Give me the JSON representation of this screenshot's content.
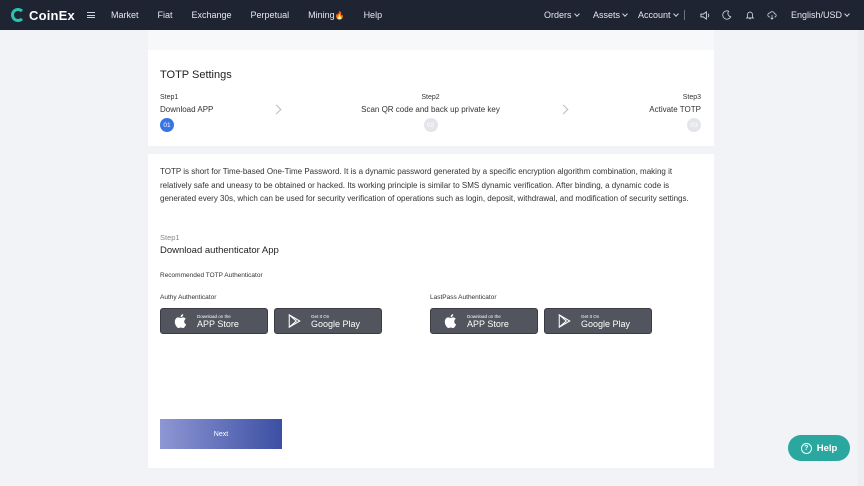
{
  "nav": {
    "logo": "CoinEx",
    "items": [
      "Market",
      "Fiat",
      "Exchange",
      "Perpetual",
      "Mining",
      "Help"
    ],
    "orders": "Orders",
    "assets": "Assets",
    "account": "Account",
    "language": "English/USD"
  },
  "page": {
    "title": "TOTP Settings",
    "steps": [
      {
        "step": "Step1",
        "label": "Download APP",
        "num": "01"
      },
      {
        "step": "Step2",
        "label": "Scan QR code and back up private key",
        "num": "02"
      },
      {
        "step": "Step3",
        "label": "Activate TOTP",
        "num": "03"
      }
    ],
    "active_step": 1,
    "description": "TOTP is short for Time-based One-Time Password. It is a dynamic password generated by a specific encryption algorithm combination, making it relatively safe and uneasy to be obtained or hacked. Its working principle is similar to SMS dynamic verification. After binding, a dynamic code is generated every 30s, which can be used for security verification of operations such as login, deposit, withdrawal, and modification of security settings.",
    "sub_step": "Step1",
    "sub_title": "Download authenticator App",
    "recommended": "Recommended TOTP Authenticator",
    "authenticators": [
      {
        "name": "Authy Authenticator"
      },
      {
        "name": "LastPass Authenticator"
      }
    ],
    "app_store": {
      "small": "Download on the",
      "big": "APP Store"
    },
    "google_play": {
      "small": "Get It On",
      "big": "Google Play"
    },
    "next": "Next"
  },
  "help_button": "Help",
  "colors": {
    "nav_bg": "#1f2433",
    "accent": "#3774e4",
    "help": "#2aa8a0",
    "brand": "#2ac3ae"
  }
}
